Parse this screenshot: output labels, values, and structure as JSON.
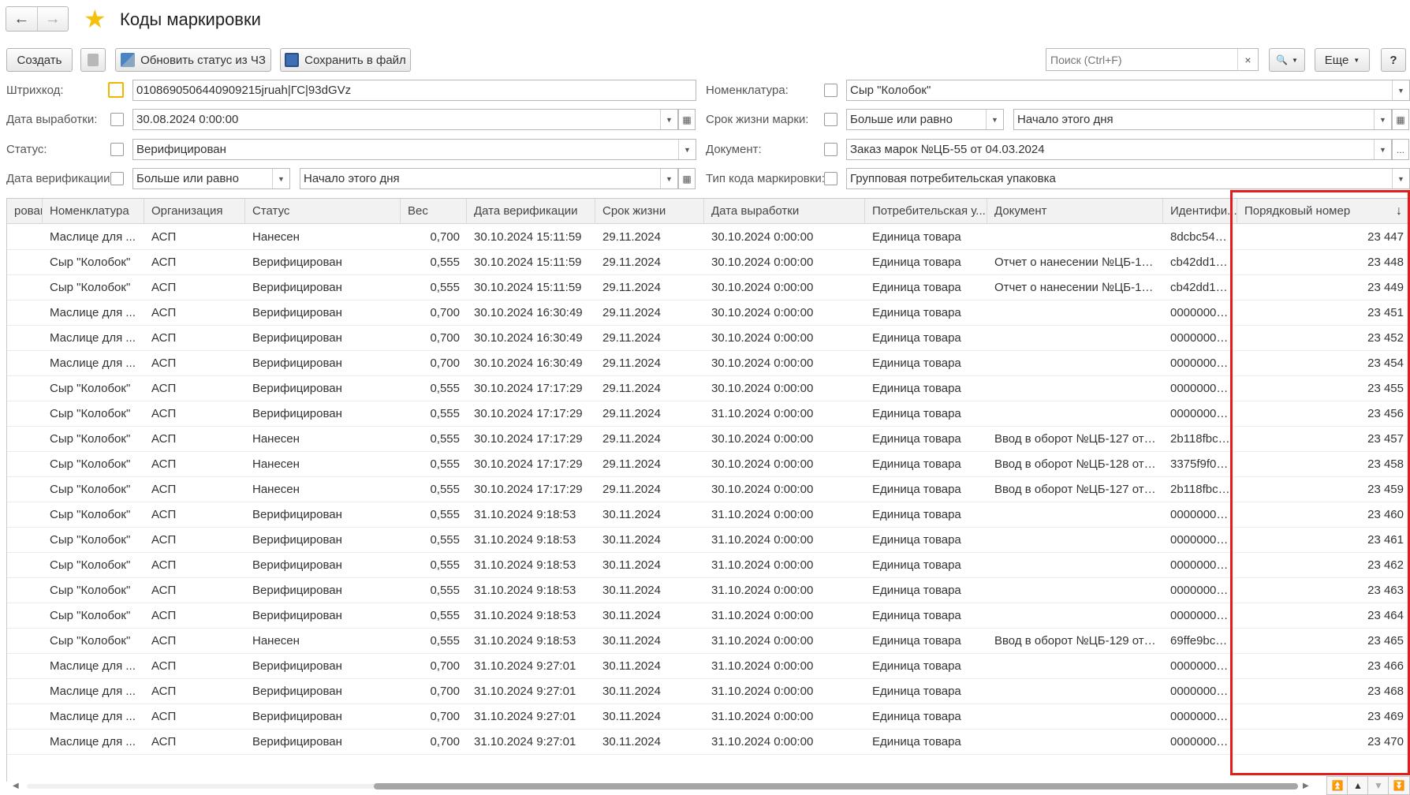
{
  "window": {
    "title": "Коды маркировки",
    "back_icon": "←",
    "forward_icon": "→",
    "star_icon": "★"
  },
  "toolbar": {
    "create": "Создать",
    "update_status": "Обновить статус из ЧЗ",
    "save_file": "Сохранить в файл",
    "search_placeholder": "Поиск (Ctrl+F)",
    "clear_icon": "×",
    "search_icon": "🔍",
    "more": "Еще",
    "help": "?"
  },
  "filters": {
    "barcode_label": "Штрихкод:",
    "barcode_value": "0108690506440909215jruah|ГС|93dGVz",
    "prod_date_label": "Дата выработки:",
    "prod_date_value": "30.08.2024  0:00:00",
    "status_label": "Статус:",
    "status_value": "Верифицирован",
    "verif_date_label": "Дата верификации:",
    "verif_cmp_value": "Больше или равно",
    "verif_date_value": "Начало этого дня",
    "nomenclature_label": "Номенклатура:",
    "nomenclature_value": "Сыр \"Колобок\"",
    "lifetime_label": "Срок жизни марки:",
    "lifetime_cmp_value": "Больше или равно",
    "lifetime_value": "Начало этого дня",
    "document_label": "Документ:",
    "document_value": "Заказ марок №ЦБ-55 от 04.03.2024",
    "code_type_label": "Тип кода маркировки:",
    "code_type_value": "Групповая потребительская упаковка",
    "ellipsis": "..."
  },
  "table": {
    "sort_icon": "↓",
    "columns": [
      "рован",
      "Номенклатура",
      "Организация",
      "Статус",
      "Вес",
      "Дата верификации",
      "Срок жизни",
      "Дата выработки",
      "Потребительская у...",
      "Документ",
      "Идентифи...",
      "Порядковый номер"
    ],
    "rows": [
      [
        "",
        "Маслице для ...",
        "АСП",
        "Нанесен",
        "0,700",
        "30.10.2024 15:11:59",
        "29.11.2024",
        "30.10.2024 0:00:00",
        "Единица товара",
        "",
        "8dcbc54a...",
        "23 447"
      ],
      [
        "",
        "Сыр \"Колобок\"",
        "АСП",
        "Верифицирован",
        "0,555",
        "30.10.2024 15:11:59",
        "29.11.2024",
        "30.10.2024 0:00:00",
        "Единица товара",
        "Отчет о нанесении №ЦБ-18...",
        "cb42dd1f-...",
        "23 448"
      ],
      [
        "",
        "Сыр \"Колобок\"",
        "АСП",
        "Верифицирован",
        "0,555",
        "30.10.2024 15:11:59",
        "29.11.2024",
        "30.10.2024 0:00:00",
        "Единица товара",
        "Отчет о нанесении №ЦБ-18...",
        "cb42dd1f-...",
        "23 449"
      ],
      [
        "",
        "Маслице для ...",
        "АСП",
        "Верифицирован",
        "0,700",
        "30.10.2024 16:30:49",
        "29.11.2024",
        "30.10.2024 0:00:00",
        "Единица товара",
        "",
        "00000000...",
        "23 451"
      ],
      [
        "",
        "Маслице для ...",
        "АСП",
        "Верифицирован",
        "0,700",
        "30.10.2024 16:30:49",
        "29.11.2024",
        "30.10.2024 0:00:00",
        "Единица товара",
        "",
        "00000000...",
        "23 452"
      ],
      [
        "",
        "Маслице для ...",
        "АСП",
        "Верифицирован",
        "0,700",
        "30.10.2024 16:30:49",
        "29.11.2024",
        "30.10.2024 0:00:00",
        "Единица товара",
        "",
        "00000000...",
        "23 454"
      ],
      [
        "",
        "Сыр \"Колобок\"",
        "АСП",
        "Верифицирован",
        "0,555",
        "30.10.2024 17:17:29",
        "29.11.2024",
        "30.10.2024 0:00:00",
        "Единица товара",
        "",
        "00000000...",
        "23 455"
      ],
      [
        "",
        "Сыр \"Колобок\"",
        "АСП",
        "Верифицирован",
        "0,555",
        "30.10.2024 17:17:29",
        "29.11.2024",
        "31.10.2024 0:00:00",
        "Единица товара",
        "",
        "00000000...",
        "23 456"
      ],
      [
        "",
        "Сыр \"Колобок\"",
        "АСП",
        "Нанесен",
        "0,555",
        "30.10.2024 17:17:29",
        "29.11.2024",
        "30.10.2024 0:00:00",
        "Единица товара",
        "Ввод в оборот №ЦБ-127 от ...",
        "2b118fbc-...",
        "23 457"
      ],
      [
        "",
        "Сыр \"Колобок\"",
        "АСП",
        "Нанесен",
        "0,555",
        "30.10.2024 17:17:29",
        "29.11.2024",
        "30.10.2024 0:00:00",
        "Единица товара",
        "Ввод в оборот №ЦБ-128 от ...",
        "3375f9f0-e...",
        "23 458"
      ],
      [
        "",
        "Сыр \"Колобок\"",
        "АСП",
        "Нанесен",
        "0,555",
        "30.10.2024 17:17:29",
        "29.11.2024",
        "30.10.2024 0:00:00",
        "Единица товара",
        "Ввод в оборот №ЦБ-127 от ...",
        "2b118fbc-...",
        "23 459"
      ],
      [
        "",
        "Сыр \"Колобок\"",
        "АСП",
        "Верифицирован",
        "0,555",
        "31.10.2024 9:18:53",
        "30.11.2024",
        "31.10.2024 0:00:00",
        "Единица товара",
        "",
        "00000000...",
        "23 460"
      ],
      [
        "",
        "Сыр \"Колобок\"",
        "АСП",
        "Верифицирован",
        "0,555",
        "31.10.2024 9:18:53",
        "30.11.2024",
        "31.10.2024 0:00:00",
        "Единица товара",
        "",
        "00000000...",
        "23 461"
      ],
      [
        "",
        "Сыр \"Колобок\"",
        "АСП",
        "Верифицирован",
        "0,555",
        "31.10.2024 9:18:53",
        "30.11.2024",
        "31.10.2024 0:00:00",
        "Единица товара",
        "",
        "00000000...",
        "23 462"
      ],
      [
        "",
        "Сыр \"Колобок\"",
        "АСП",
        "Верифицирован",
        "0,555",
        "31.10.2024 9:18:53",
        "30.11.2024",
        "31.10.2024 0:00:00",
        "Единица товара",
        "",
        "00000000...",
        "23 463"
      ],
      [
        "",
        "Сыр \"Колобок\"",
        "АСП",
        "Верифицирован",
        "0,555",
        "31.10.2024 9:18:53",
        "30.11.2024",
        "31.10.2024 0:00:00",
        "Единица товара",
        "",
        "00000000...",
        "23 464"
      ],
      [
        "",
        "Сыр \"Колобок\"",
        "АСП",
        "Нанесен",
        "0,555",
        "31.10.2024 9:18:53",
        "30.11.2024",
        "31.10.2024 0:00:00",
        "Единица товара",
        "Ввод в оборот №ЦБ-129 от ...",
        "69ffe9bc-0...",
        "23 465"
      ],
      [
        "",
        "Маслице для ...",
        "АСП",
        "Верифицирован",
        "0,700",
        "31.10.2024 9:27:01",
        "30.11.2024",
        "31.10.2024 0:00:00",
        "Единица товара",
        "",
        "00000000...",
        "23 466"
      ],
      [
        "",
        "Маслице для ...",
        "АСП",
        "Верифицирован",
        "0,700",
        "31.10.2024 9:27:01",
        "30.11.2024",
        "31.10.2024 0:00:00",
        "Единица товара",
        "",
        "00000000...",
        "23 468"
      ],
      [
        "",
        "Маслице для ...",
        "АСП",
        "Верифицирован",
        "0,700",
        "31.10.2024 9:27:01",
        "30.11.2024",
        "31.10.2024 0:00:00",
        "Единица товара",
        "",
        "00000000...",
        "23 469"
      ],
      [
        "",
        "Маслице для ...",
        "АСП",
        "Верифицирован",
        "0,700",
        "31.10.2024 9:27:01",
        "30.11.2024",
        "31.10.2024 0:00:00",
        "Единица товара",
        "",
        "00000000...",
        "23 470"
      ]
    ]
  },
  "footer": {
    "first_icon": "⏫",
    "up_icon": "▲",
    "down_icon": "▼",
    "last_icon": "⏬",
    "scroll_left": "◀",
    "scroll_right": "▶"
  },
  "colors": {
    "highlight": "#e31c1c",
    "star": "#f4c20d",
    "focus": "#f2b500"
  }
}
